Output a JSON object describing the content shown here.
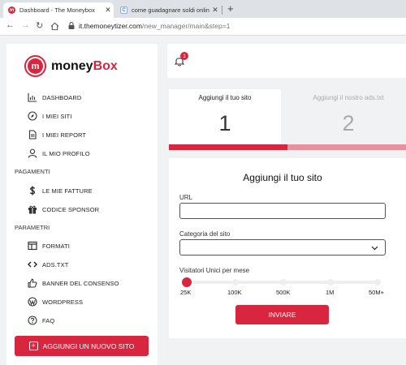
{
  "browser": {
    "tabs": [
      {
        "title": "Dashboard - The Moneybox",
        "active": true
      },
      {
        "title": "come guadagnare soldi online",
        "active": false
      }
    ],
    "url_host": "it.themoneytizer.com",
    "url_path": "/new_manager/main&step=1"
  },
  "brand": {
    "name_part1": "money",
    "name_part2": "Box",
    "logo_letter": "m",
    "accent": "#d7263d"
  },
  "sidebar": {
    "items": [
      {
        "label": "DASHBOARD",
        "icon": "chart-icon"
      },
      {
        "label": "I MIEI SITI",
        "icon": "compass-icon"
      },
      {
        "label": "I MIEI REPORT",
        "icon": "document-icon"
      },
      {
        "label": "IL MIO PROFILO",
        "icon": "user-icon"
      }
    ],
    "section_payments": "PAGAMENTI",
    "payment_items": [
      {
        "label": "LE MIE FATTURE",
        "icon": "dollar-icon"
      },
      {
        "label": "CODICE SPONSOR",
        "icon": "gift-icon"
      }
    ],
    "section_params": "PARAMETRI",
    "param_items": [
      {
        "label": "FORMATI",
        "icon": "layout-icon"
      },
      {
        "label": "ADS.TXT",
        "icon": "code-icon"
      },
      {
        "label": "BANNER DEL CONSENSO",
        "icon": "thumbs-up-icon"
      },
      {
        "label": "WORDPRESS",
        "icon": "wordpress-icon"
      },
      {
        "label": "FAQ",
        "icon": "help-icon"
      }
    ],
    "add_site_label": "AGGIUNGI UN NUOVO SITO"
  },
  "topbar": {
    "notifications_count": "1"
  },
  "steps": [
    {
      "label": "Aggiungi il tuo sito",
      "number": "1",
      "active": true
    },
    {
      "label": "Aggiungi il nostro ads.txt",
      "number": "2",
      "active": false
    }
  ],
  "form": {
    "title": "Aggiungi il tuo sito",
    "url_label": "URL",
    "url_value": "",
    "category_label": "Categoria del sito",
    "category_value": "",
    "visitors_label": "Visitatori Unici per mese",
    "visitors_ticks": [
      "25K",
      "100K",
      "500K",
      "1M",
      "50M+"
    ],
    "visitors_selected_index": 0,
    "submit_label": "INVIARE"
  }
}
